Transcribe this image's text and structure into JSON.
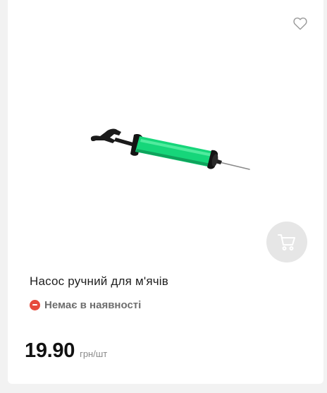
{
  "product": {
    "name": "Насос ручний для м'ячів",
    "availability": "Немає в наявності",
    "price": "19.90",
    "price_unit": "грн/шт",
    "image_alt": "hand-pump-image"
  },
  "icons": {
    "wishlist": "heart-outline-icon",
    "cart": "shopping-cart-icon",
    "availability": "minus-circle-icon"
  },
  "colors": {
    "pump_body": "#16d67a",
    "unavailable": "#e64a3c",
    "cart_button_bg": "#e6e6e6"
  }
}
